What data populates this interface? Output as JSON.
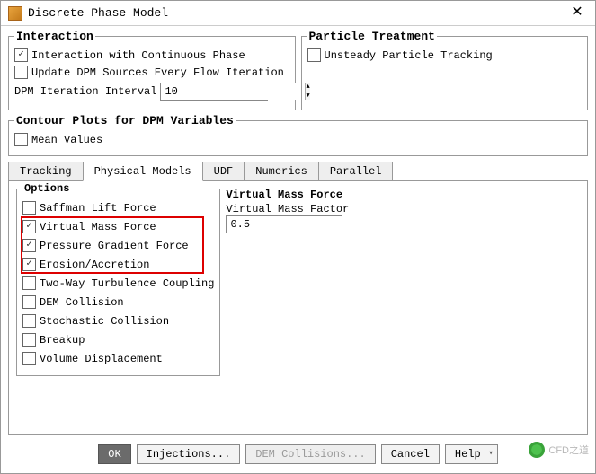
{
  "title": "Discrete Phase Model",
  "interaction": {
    "legend": "Interaction",
    "with_continuous": {
      "label": "Interaction with Continuous Phase",
      "checked": true
    },
    "update_sources": {
      "label": "Update DPM Sources Every Flow Iteration",
      "checked": false
    },
    "interval_label": "DPM Iteration Interval",
    "interval_value": "10"
  },
  "particle": {
    "legend": "Particle Treatment",
    "unsteady": {
      "label": "Unsteady Particle Tracking",
      "checked": false
    }
  },
  "contour": {
    "legend": "Contour Plots for DPM Variables",
    "mean": {
      "label": "Mean Values",
      "checked": false
    }
  },
  "tabs": {
    "tracking": "Tracking",
    "physical": "Physical Models",
    "udf": "UDF",
    "numerics": "Numerics",
    "parallel": "Parallel"
  },
  "options": {
    "legend": "Options",
    "items": [
      {
        "label": "Saffman Lift Force",
        "checked": false
      },
      {
        "label": "Virtual Mass Force",
        "checked": true
      },
      {
        "label": "Pressure Gradient Force",
        "checked": true
      },
      {
        "label": "Erosion/Accretion",
        "checked": true
      },
      {
        "label": "Two-Way Turbulence Coupling",
        "checked": false
      },
      {
        "label": "DEM Collision",
        "checked": false
      },
      {
        "label": "Stochastic Collision",
        "checked": false
      },
      {
        "label": "Breakup",
        "checked": false
      },
      {
        "label": "Volume Displacement",
        "checked": false
      }
    ]
  },
  "vmf": {
    "legend": "Virtual Mass Force",
    "factor_label": "Virtual Mass Factor",
    "factor_value": "0.5"
  },
  "buttons": {
    "ok": "OK",
    "injections": "Injections...",
    "dem": "DEM Collisions...",
    "cancel": "Cancel",
    "help": "Help"
  },
  "watermark": "CFD之道"
}
